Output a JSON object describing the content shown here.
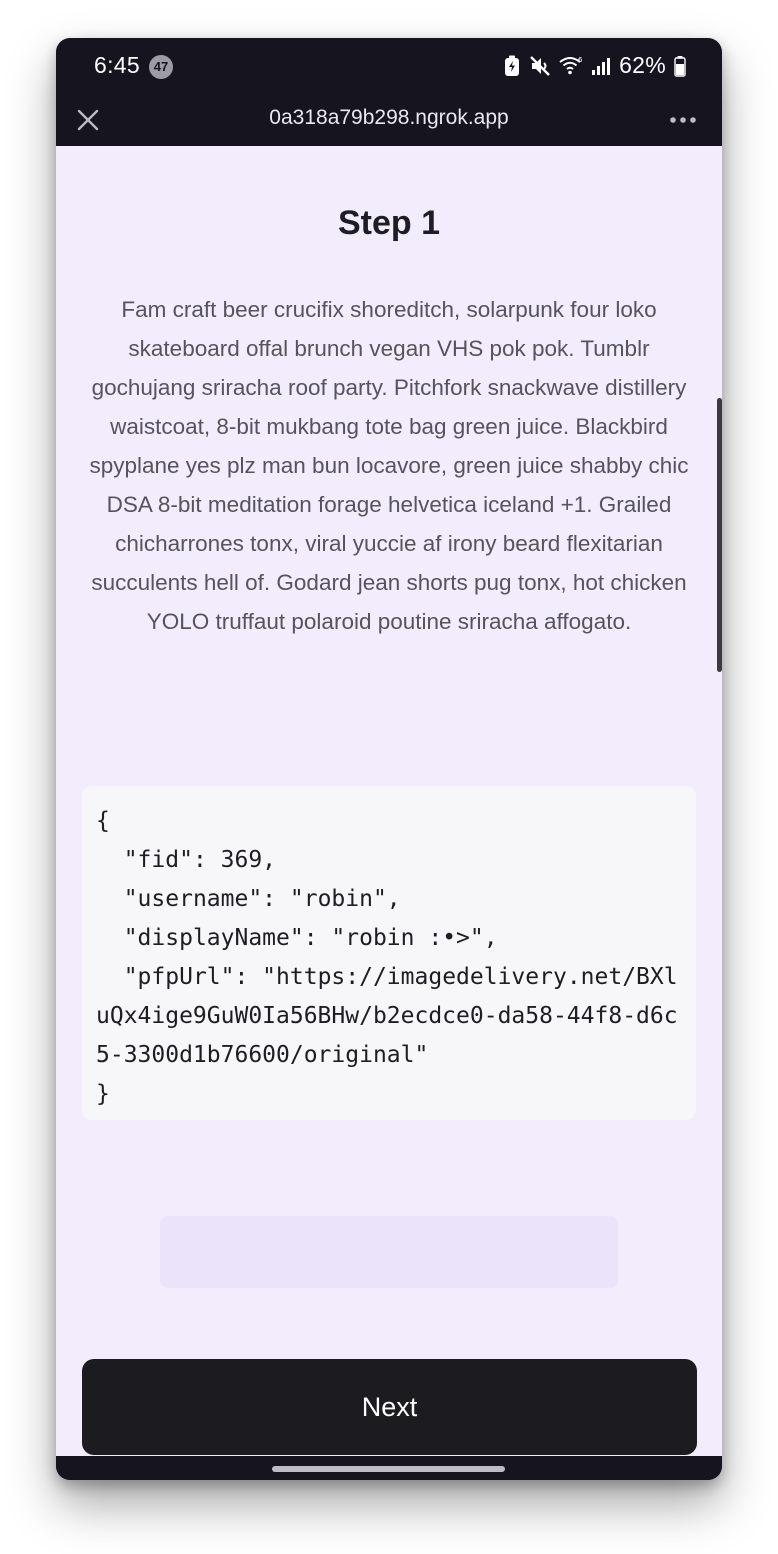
{
  "status_bar": {
    "time": "6:45",
    "notification_count": "47",
    "battery_percent": "62%"
  },
  "browser": {
    "url": "0a318a79b298.ngrok.app"
  },
  "page": {
    "title": "Step 1",
    "description": "Fam craft beer crucifix shoreditch, solarpunk four loko skateboard offal brunch vegan VHS pok pok. Tumblr gochujang sriracha roof party. Pitchfork snackwave distillery waistcoat, 8-bit mukbang tote bag green juice. Blackbird spyplane yes plz man bun locavore, green juice shabby chic DSA 8-bit meditation forage helvetica iceland +1. Grailed chicharrones tonx, viral yuccie af irony beard flexitarian succulents hell of. Godard jean shorts pug tonx, hot chicken YOLO truffaut polaroid poutine sriracha affogato.",
    "code": "{\n  \"fid\": 369,\n  \"username\": \"robin\",\n  \"displayName\": \"robin :•>\",\n  \"pfpUrl\": \"https://imagedelivery.net/BXluQx4ige9GuW0Ia56BHw/b2ecdce0-da58-44f8-d6c5-3300d1b76600/original\"\n}",
    "next_label": "Next"
  },
  "icons": {
    "close": "close-icon",
    "more": "more-horizontal-icon",
    "battery_saver": "battery-saver-icon",
    "mute": "mute-icon",
    "wifi": "wifi-icon",
    "signal": "signal-icon",
    "battery": "battery-icon"
  },
  "colors": {
    "page_background": "#f2ecfd",
    "browser_chrome": "#16141f",
    "button": "#1c1b1f",
    "code_background": "#f7f6f8"
  }
}
